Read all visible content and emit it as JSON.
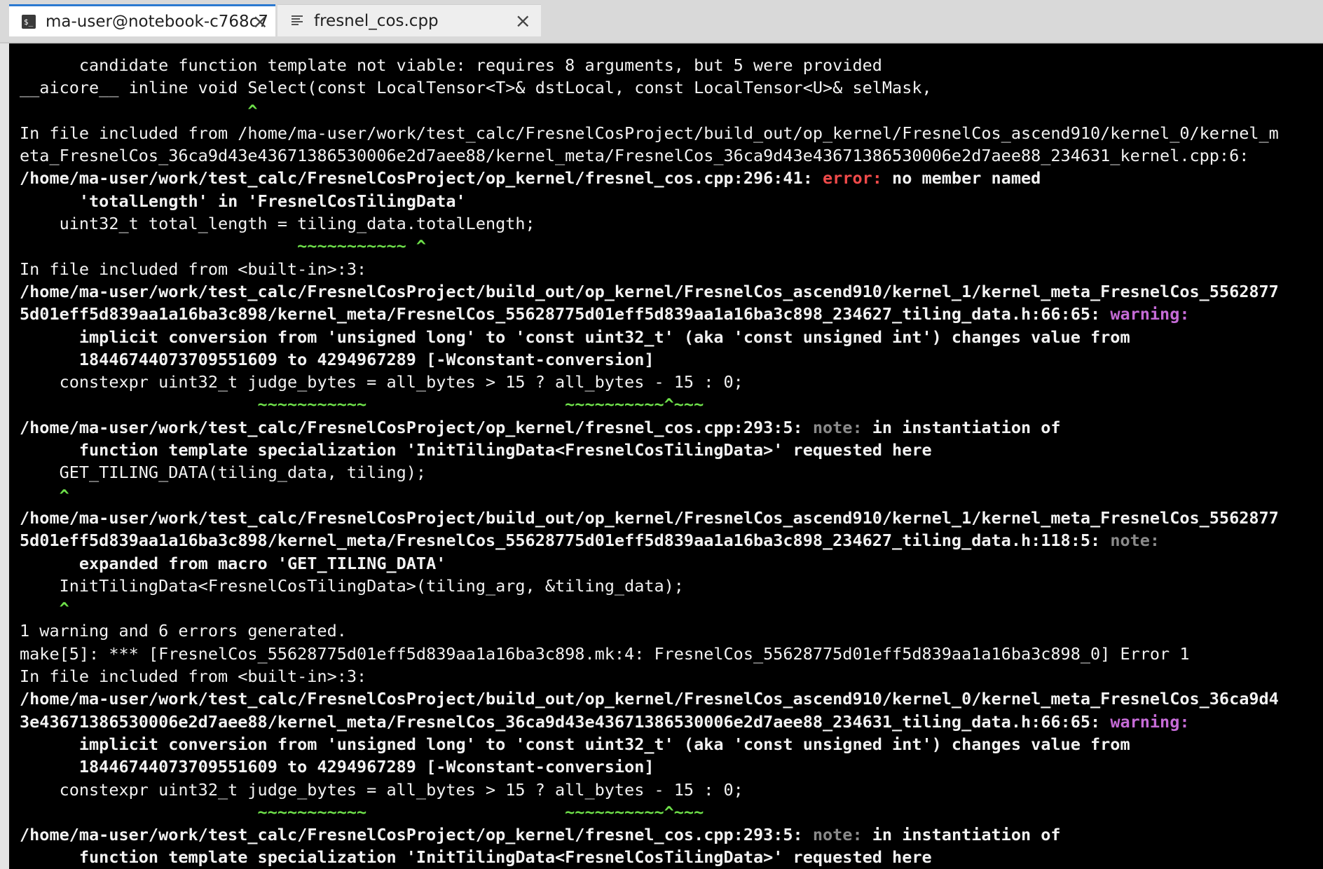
{
  "tabs": [
    {
      "label": "ma-user@notebook-c768c7",
      "icon": "terminal-icon",
      "active": true
    },
    {
      "label": "fresnel_cos.cpp",
      "icon": "document-icon",
      "active": false
    }
  ],
  "terminal": {
    "lines": [
      {
        "segments": [
          {
            "t": "      candidate function template not viable: requires 8 arguments, but 5 were provided",
            "c": ""
          }
        ]
      },
      {
        "segments": [
          {
            "t": "__aicore__ inline void Select(const LocalTensor<T>& dstLocal, const LocalTensor<U>& selMask,",
            "c": ""
          }
        ]
      },
      {
        "segments": [
          {
            "t": "                       ^",
            "c": "grn"
          }
        ]
      },
      {
        "segments": [
          {
            "t": "In file included from /home/ma-user/work/test_calc/FresnelCosProject/build_out/op_kernel/FresnelCos_ascend910/kernel_0/kernel_m",
            "c": ""
          }
        ]
      },
      {
        "segments": [
          {
            "t": "eta_FresnelCos_36ca9d43e43671386530006e2d7aee88/kernel_meta/FresnelCos_36ca9d43e43671386530006e2d7aee88_234631_kernel.cpp:6:",
            "c": ""
          }
        ]
      },
      {
        "segments": [
          {
            "t": "/home/ma-user/work/test_calc/FresnelCosProject/op_kernel/fresnel_cos.cpp:296:41: ",
            "c": "b"
          },
          {
            "t": "error:",
            "c": "err"
          },
          {
            "t": " no member named",
            "c": "b"
          }
        ]
      },
      {
        "segments": [
          {
            "t": "      'totalLength' in 'FresnelCosTilingData'",
            "c": "b"
          }
        ]
      },
      {
        "segments": [
          {
            "t": "    uint32_t total_length = tiling_data.totalLength;",
            "c": ""
          }
        ]
      },
      {
        "segments": [
          {
            "t": "                            ~~~~~~~~~~~ ^",
            "c": "grn"
          }
        ]
      },
      {
        "segments": [
          {
            "t": "In file included from <built-in>:3:",
            "c": ""
          }
        ]
      },
      {
        "segments": [
          {
            "t": "/home/ma-user/work/test_calc/FresnelCosProject/build_out/op_kernel/FresnelCos_ascend910/kernel_1/kernel_meta_FresnelCos_5562877",
            "c": "b"
          }
        ]
      },
      {
        "segments": [
          {
            "t": "5d01eff5d839aa1a16ba3c898/kernel_meta/FresnelCos_55628775d01eff5d839aa1a16ba3c898_234627_tiling_data.h:66:65: ",
            "c": "b"
          },
          {
            "t": "warning:",
            "c": "warn"
          }
        ]
      },
      {
        "segments": [
          {
            "t": "      implicit conversion from 'unsigned long' to 'const uint32_t' (aka 'const unsigned int') changes value from",
            "c": "b"
          }
        ]
      },
      {
        "segments": [
          {
            "t": "      18446744073709551609 to 4294967289 [-Wconstant-conversion]",
            "c": "b"
          }
        ]
      },
      {
        "segments": [
          {
            "t": "    constexpr uint32_t judge_bytes = all_bytes > 15 ? all_bytes - 15 : 0;",
            "c": ""
          }
        ]
      },
      {
        "segments": [
          {
            "t": "                        ~~~~~~~~~~~                    ~~~~~~~~~~^~~~",
            "c": "grn"
          }
        ]
      },
      {
        "segments": [
          {
            "t": "/home/ma-user/work/test_calc/FresnelCosProject/op_kernel/fresnel_cos.cpp:293:5: ",
            "c": "b"
          },
          {
            "t": "note:",
            "c": "note"
          },
          {
            "t": " in instantiation of",
            "c": "b"
          }
        ]
      },
      {
        "segments": [
          {
            "t": "      function template specialization 'InitTilingData<FresnelCosTilingData>' requested here",
            "c": "b"
          }
        ]
      },
      {
        "segments": [
          {
            "t": "    GET_TILING_DATA(tiling_data, tiling);",
            "c": ""
          }
        ]
      },
      {
        "segments": [
          {
            "t": "    ^",
            "c": "grn"
          }
        ]
      },
      {
        "segments": [
          {
            "t": "/home/ma-user/work/test_calc/FresnelCosProject/build_out/op_kernel/FresnelCos_ascend910/kernel_1/kernel_meta_FresnelCos_5562877",
            "c": "b"
          }
        ]
      },
      {
        "segments": [
          {
            "t": "5d01eff5d839aa1a16ba3c898/kernel_meta/FresnelCos_55628775d01eff5d839aa1a16ba3c898_234627_tiling_data.h:118:5: ",
            "c": "b"
          },
          {
            "t": "note:",
            "c": "note"
          }
        ]
      },
      {
        "segments": [
          {
            "t": "      expanded from macro 'GET_TILING_DATA'",
            "c": "b"
          }
        ]
      },
      {
        "segments": [
          {
            "t": "    InitTilingData<FresnelCosTilingData>(tiling_arg, &tiling_data);",
            "c": ""
          }
        ]
      },
      {
        "segments": [
          {
            "t": "    ^",
            "c": "grn"
          }
        ]
      },
      {
        "segments": [
          {
            "t": "1 warning and 6 errors generated.",
            "c": ""
          }
        ]
      },
      {
        "segments": [
          {
            "t": "make[5]: *** [FresnelCos_55628775d01eff5d839aa1a16ba3c898.mk:4: FresnelCos_55628775d01eff5d839aa1a16ba3c898_0] Error 1",
            "c": ""
          }
        ]
      },
      {
        "segments": [
          {
            "t": "In file included from <built-in>:3:",
            "c": ""
          }
        ]
      },
      {
        "segments": [
          {
            "t": "/home/ma-user/work/test_calc/FresnelCosProject/build_out/op_kernel/FresnelCos_ascend910/kernel_0/kernel_meta_FresnelCos_36ca9d4",
            "c": "b"
          }
        ]
      },
      {
        "segments": [
          {
            "t": "3e43671386530006e2d7aee88/kernel_meta/FresnelCos_36ca9d43e43671386530006e2d7aee88_234631_tiling_data.h:66:65: ",
            "c": "b"
          },
          {
            "t": "warning:",
            "c": "warn"
          }
        ]
      },
      {
        "segments": [
          {
            "t": "      implicit conversion from 'unsigned long' to 'const uint32_t' (aka 'const unsigned int') changes value from",
            "c": "b"
          }
        ]
      },
      {
        "segments": [
          {
            "t": "      18446744073709551609 to 4294967289 [-Wconstant-conversion]",
            "c": "b"
          }
        ]
      },
      {
        "segments": [
          {
            "t": "    constexpr uint32_t judge_bytes = all_bytes > 15 ? all_bytes - 15 : 0;",
            "c": ""
          }
        ]
      },
      {
        "segments": [
          {
            "t": "                        ~~~~~~~~~~~                    ~~~~~~~~~~^~~~",
            "c": "grn"
          }
        ]
      },
      {
        "segments": [
          {
            "t": "/home/ma-user/work/test_calc/FresnelCosProject/op_kernel/fresnel_cos.cpp:293:5: ",
            "c": "b"
          },
          {
            "t": "note:",
            "c": "note"
          },
          {
            "t": " in instantiation of",
            "c": "b"
          }
        ]
      },
      {
        "segments": [
          {
            "t": "      function template specialization 'InitTilingData<FresnelCosTilingData>' requested here",
            "c": "b"
          }
        ]
      }
    ]
  },
  "colors": {
    "terminal_bg": "#000000",
    "error": "#f04a4a",
    "warning": "#c56bd6",
    "note": "#8a8a8a",
    "caret": "#6ee04a",
    "active_tab_accent": "#2b79d0"
  }
}
